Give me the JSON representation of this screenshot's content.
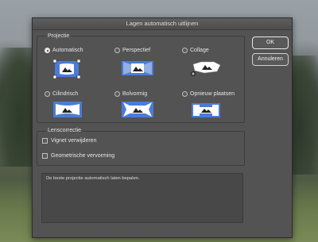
{
  "dialog": {
    "title": "Lagen automatisch uitlijnen"
  },
  "projection": {
    "label": "Projectie",
    "options": [
      {
        "label": "Automatisch",
        "selected": true,
        "icon": "auto-projection-icon"
      },
      {
        "label": "Perspectief",
        "selected": false,
        "icon": "perspective-projection-icon"
      },
      {
        "label": "Collage",
        "selected": false,
        "icon": "collage-projection-icon"
      },
      {
        "label": "Cilindrisch",
        "selected": false,
        "icon": "cylindrical-projection-icon"
      },
      {
        "label": "Bolvormig",
        "selected": false,
        "icon": "spherical-projection-icon"
      },
      {
        "label": "Opnieuw plaatsen",
        "selected": false,
        "icon": "reposition-projection-icon"
      }
    ]
  },
  "lens": {
    "label": "Lenscorrectie",
    "vignette": {
      "label": "Vignet verwijderen",
      "checked": false
    },
    "distortion": {
      "label": "Geometrische vervorming",
      "checked": false
    }
  },
  "description": "De beste projectie automatisch laten bepalen.",
  "buttons": {
    "ok": "OK",
    "cancel": "Annuleren"
  },
  "colors": {
    "accent_blue": "#4a7bd8",
    "dialog_bg": "#535353"
  }
}
